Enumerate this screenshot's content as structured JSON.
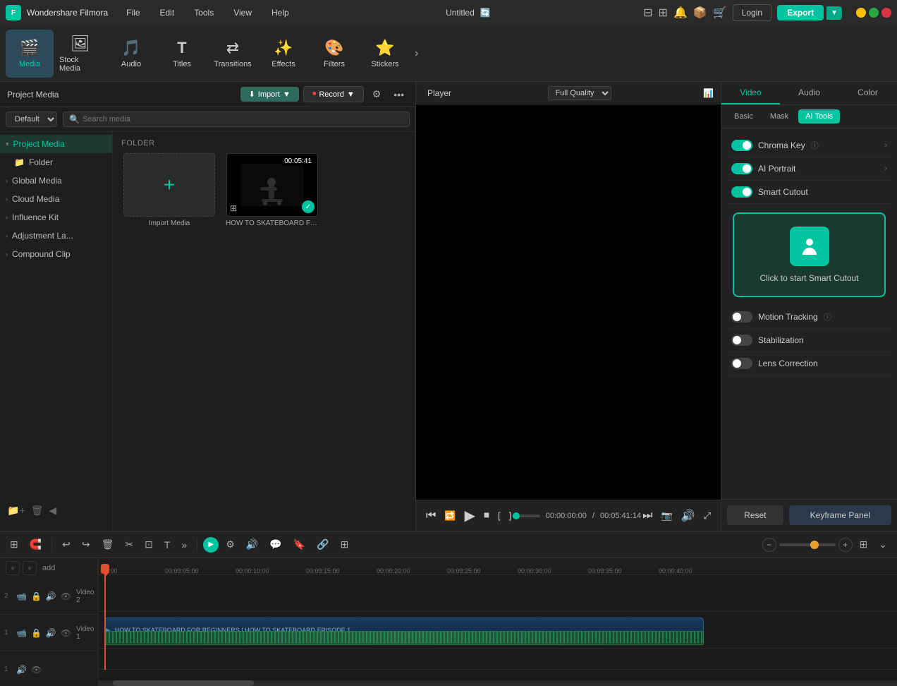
{
  "app": {
    "name": "Wondershare Filmora",
    "title": "Untitled",
    "logo": "F"
  },
  "titlebar": {
    "menu": [
      "File",
      "Edit",
      "Tools",
      "View",
      "Help"
    ],
    "login_label": "Login",
    "export_label": "Export"
  },
  "toolbar": {
    "items": [
      {
        "id": "media",
        "icon": "🎬",
        "label": "Media",
        "active": true
      },
      {
        "id": "stock-media",
        "icon": "📷",
        "label": "Stock Media"
      },
      {
        "id": "audio",
        "icon": "🎵",
        "label": "Audio"
      },
      {
        "id": "titles",
        "icon": "T",
        "label": "Titles"
      },
      {
        "id": "transitions",
        "icon": "⟷",
        "label": "Transitions"
      },
      {
        "id": "effects",
        "icon": "✨",
        "label": "Effects"
      },
      {
        "id": "filters",
        "icon": "🎨",
        "label": "Filters"
      },
      {
        "id": "stickers",
        "icon": "⭐",
        "label": "Stickers"
      }
    ],
    "more": "›"
  },
  "panel": {
    "header": {
      "import_label": "Import",
      "record_label": "Record"
    },
    "search": {
      "placeholder": "Search media",
      "default_select": "Default"
    },
    "folder_label": "FOLDER",
    "import_media_label": "Import Media"
  },
  "sidebar": {
    "items": [
      {
        "id": "project-media",
        "label": "Project Media",
        "active": true
      },
      {
        "id": "folder",
        "label": "Folder",
        "indent": true
      },
      {
        "id": "global-media",
        "label": "Global Media"
      },
      {
        "id": "cloud-media",
        "label": "Cloud Media"
      },
      {
        "id": "influence-kit",
        "label": "Influence Kit"
      },
      {
        "id": "adjustment-la",
        "label": "Adjustment La..."
      },
      {
        "id": "compound-clip",
        "label": "Compound Clip"
      }
    ]
  },
  "media": {
    "clip": {
      "duration": "00:05:41",
      "title": "HOW TO SKATEBOARD FOR ...",
      "full_title": "HOW TO SKATEBOARD FOR BEGINNERS | HOW TO SKATEBOARD EPISODE 1"
    }
  },
  "player": {
    "tab_player": "Player",
    "tab_quality": "Full Quality",
    "time_current": "00:00:00:00",
    "time_total": "00:05:41:14",
    "separator": "/"
  },
  "properties": {
    "tabs": [
      "Video",
      "Audio",
      "Color"
    ],
    "active_tab": "Video",
    "sub_tabs": [
      "Basic",
      "Mask",
      "AI Tools"
    ],
    "active_sub_tab": "AI Tools",
    "ai_tools": [
      {
        "id": "chroma-key",
        "label": "Chroma Key",
        "enabled": true,
        "has_info": true,
        "has_expand": true
      },
      {
        "id": "ai-portrait",
        "label": "AI Portrait",
        "enabled": true,
        "has_info": false,
        "has_expand": true
      },
      {
        "id": "smart-cutout",
        "label": "Smart Cutout",
        "enabled": true,
        "has_info": false,
        "has_expand": false
      }
    ],
    "smart_cutout_action": "Click to start Smart Cutout",
    "additional_tools": [
      {
        "id": "motion-tracking",
        "label": "Motion Tracking",
        "enabled": false,
        "has_info": true
      },
      {
        "id": "stabilization",
        "label": "Stabilization",
        "enabled": false
      },
      {
        "id": "lens-correction",
        "label": "Lens Correction",
        "enabled": false
      }
    ],
    "btn_reset": "Reset",
    "btn_keyframe": "Keyframe Panel"
  },
  "timeline": {
    "tracks": [
      {
        "id": "video2",
        "name": "Video 2",
        "num": "2",
        "type": "video"
      },
      {
        "id": "video1",
        "name": "Video 1",
        "num": "1",
        "type": "video"
      },
      {
        "id": "audio1",
        "name": "",
        "num": "1",
        "type": "audio"
      }
    ],
    "time_marks": [
      "00:00",
      "00:00:05:00",
      "00:00:10:00",
      "00:00:15:00",
      "00:00:20:00",
      "00:00:25:00",
      "00:00:30:00",
      "00:00:35:00",
      "00:00:40:00"
    ],
    "clip_label": "HOW TO SKATEBOARD FOR BEGINNERS | HOW TO SKATEBOARD EPISODE 1"
  },
  "icons": {
    "chevron_right": "›",
    "chevron_down": "⌄",
    "plus": "+",
    "search": "🔍",
    "play": "▶",
    "pause": "⏸",
    "stop": "⏹",
    "rewind": "⏮",
    "forward": "⏭",
    "check": "✓",
    "more": "•••",
    "filter": "⚙",
    "undo": "↩",
    "redo": "↪",
    "delete": "🗑",
    "cut": "✂",
    "crop": "⊡",
    "text": "T",
    "settings": "⚙",
    "lock": "🔒",
    "eye": "👁",
    "audio": "🔊",
    "layout": "⊞",
    "expand": "⤢"
  }
}
